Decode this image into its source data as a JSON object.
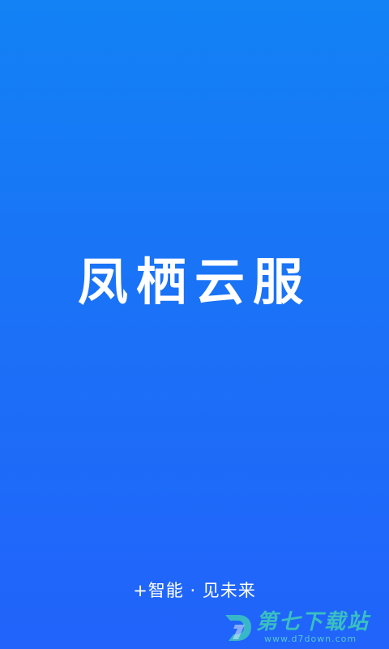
{
  "splash": {
    "title": "凤栖云服",
    "slogan": "+智能 · 见未来"
  },
  "watermark": {
    "title": "第七下载站",
    "url": "www.d7down.com",
    "logo_icon": "d7-logo-icon",
    "color": "#3fd0b8"
  },
  "colors": {
    "background_top": "#1282f5",
    "background_bottom": "#2163fb",
    "text": "#ffffff"
  }
}
